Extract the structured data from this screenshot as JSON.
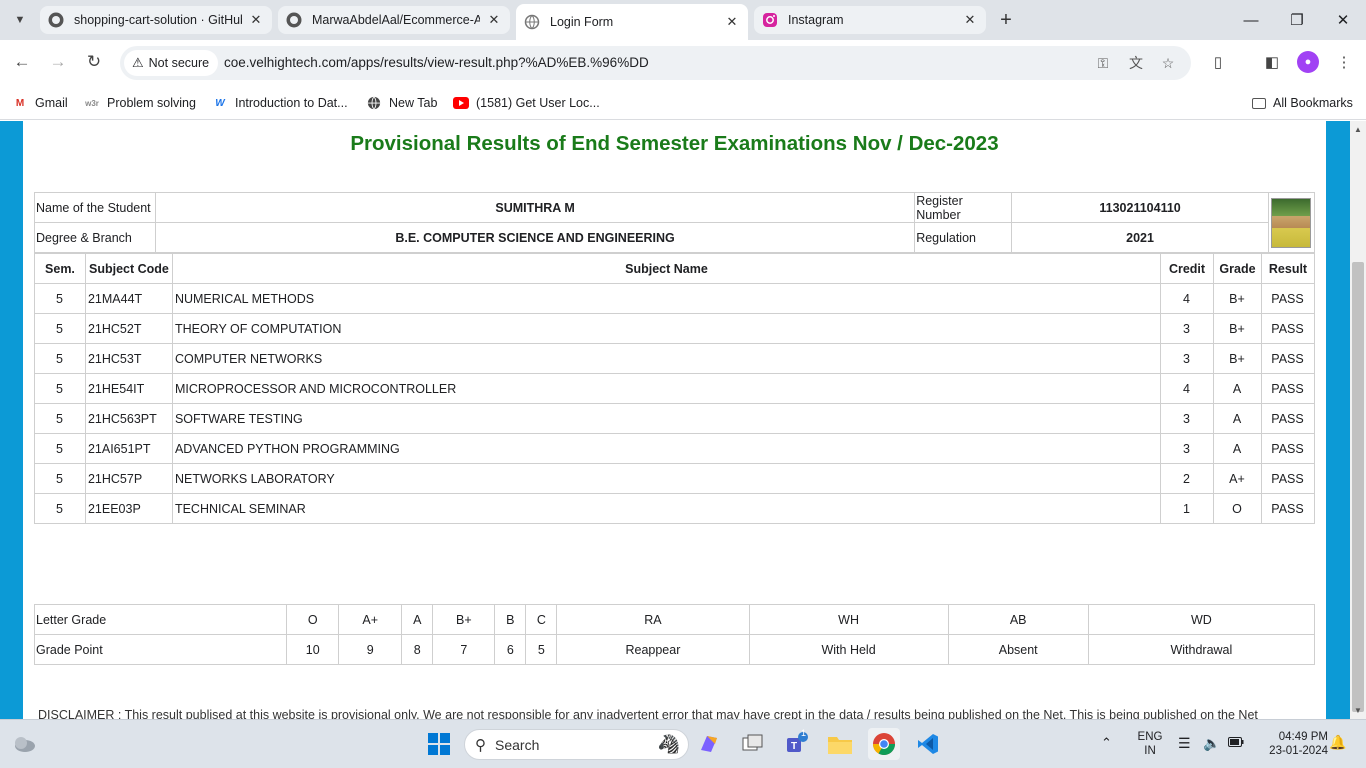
{
  "browser": {
    "tabs": [
      {
        "title": "shopping-cart-solution · GitHub",
        "favicon": "github-icon"
      },
      {
        "title": "MarwaAbdelAal/Ecommerce-Ap",
        "favicon": "github-icon"
      },
      {
        "title": "Login Form",
        "favicon": "globe-icon",
        "active": true
      },
      {
        "title": "Instagram",
        "favicon": "instagram-icon"
      }
    ],
    "security_label": "Not secure",
    "url": "coe.velhightech.com/apps/results/view-result.php?%AD%EB.%96%DD",
    "bookmarks": [
      {
        "label": "Gmail",
        "icon": "gmail-icon"
      },
      {
        "label": "Problem solving",
        "icon": "w3r-icon"
      },
      {
        "label": "Introduction to Dat...",
        "icon": "w-icon"
      },
      {
        "label": "New Tab",
        "icon": "globe-icon"
      },
      {
        "label": "(1581) Get User Loc...",
        "icon": "youtube-icon"
      }
    ],
    "all_bookmarks": "All Bookmarks"
  },
  "page": {
    "title": "Provisional Results of End Semester Examinations Nov / Dec-2023",
    "student": {
      "name_label": "Name of the Student",
      "name": "SUMITHRA M",
      "regno_label": "Register Number",
      "regno": "113021104110",
      "degree_label": "Degree & Branch",
      "degree": "B.E. COMPUTER SCIENCE AND ENGINEERING",
      "regulation_label": "Regulation",
      "regulation": "2021"
    },
    "marks_headers": [
      "Sem.",
      "Subject Code",
      "Subject Name",
      "Credit",
      "Grade",
      "Result"
    ],
    "marks": [
      [
        "5",
        "21MA44T",
        "NUMERICAL METHODS",
        "4",
        "B+",
        "PASS"
      ],
      [
        "5",
        "21HC52T",
        "THEORY OF COMPUTATION",
        "3",
        "B+",
        "PASS"
      ],
      [
        "5",
        "21HC53T",
        "COMPUTER NETWORKS",
        "3",
        "B+",
        "PASS"
      ],
      [
        "5",
        "21HE54IT",
        "MICROPROCESSOR AND MICROCONTROLLER",
        "4",
        "A",
        "PASS"
      ],
      [
        "5",
        "21HC563PT",
        "SOFTWARE TESTING",
        "3",
        "A",
        "PASS"
      ],
      [
        "5",
        "21AI651PT",
        "ADVANCED PYTHON PROGRAMMING",
        "3",
        "A",
        "PASS"
      ],
      [
        "5",
        "21HC57P",
        "NETWORKS LABORATORY",
        "2",
        "A+",
        "PASS"
      ],
      [
        "5",
        "21EE03P",
        "TECHNICAL SEMINAR",
        "1",
        "O",
        "PASS"
      ]
    ],
    "grade_table": {
      "letter_label": "Letter Grade",
      "point_label": "Grade Point",
      "letters": [
        "O",
        "A+",
        "A",
        "B+",
        "B",
        "C",
        "RA",
        "WH",
        "AB",
        "WD"
      ],
      "points": [
        "10",
        "9",
        "8",
        "7",
        "6",
        "5",
        "Reappear",
        "With Held",
        "Absent",
        "Withdrawal"
      ]
    },
    "disclaimer": "DISCLAIMER : This result publised at this website is provisional only. We are not responsible for any inadvertent error that may have crept in the data / results being published on the Net. This is being published on the Net"
  },
  "taskbar": {
    "search_label": "Search",
    "language": "ENG",
    "region": "IN",
    "time": "04:49 PM",
    "date": "23-01-2024",
    "teams_badge": "1"
  },
  "colors": {
    "title_green": "#1a7b1a",
    "page_blue": "#0c9ad6"
  }
}
